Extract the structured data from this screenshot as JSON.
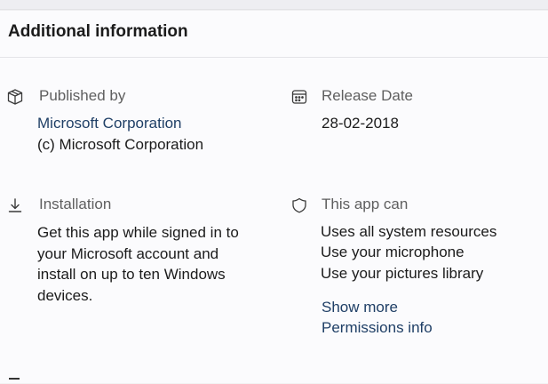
{
  "header": {
    "title": "Additional information"
  },
  "published_by": {
    "label": "Published by",
    "publisher_link": "Microsoft Corporation",
    "copyright": "(c) Microsoft Corporation"
  },
  "release_date": {
    "label": "Release Date",
    "value": "28-02-2018"
  },
  "installation": {
    "label": "Installation",
    "lines": [
      "Get this app while signed in to",
      "your Microsoft account and",
      "install on up to ten Windows",
      "devices."
    ]
  },
  "permissions": {
    "label": "This app can",
    "items": [
      "Uses all system resources",
      "Use your microphone",
      "Use your pictures library"
    ],
    "show_more": "Show more",
    "permissions_info": "Permissions info"
  },
  "icons": {
    "published_by": "package-icon",
    "release_date": "calendar-icon",
    "installation": "download-icon",
    "permissions": "shield-icon"
  }
}
